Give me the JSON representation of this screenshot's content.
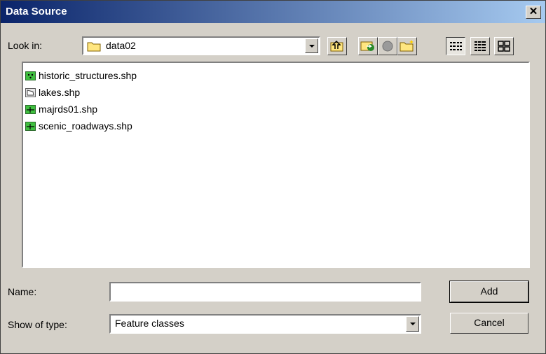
{
  "window": {
    "title": "Data Source",
    "close_glyph": "✕"
  },
  "lookin": {
    "label": "Look in:",
    "value": "data02",
    "icon": "folder-icon"
  },
  "toolbar": [
    {
      "name": "up-one-level-button",
      "icon": "up-folder-icon"
    },
    {
      "name": "connect-folder-button",
      "icon": "connect-folder-icon"
    },
    {
      "name": "disconnect-folder-button",
      "icon": "disconnect-folder-icon"
    },
    {
      "name": "new-folder-button",
      "icon": "new-folder-icon"
    },
    {
      "name": "list-view-button",
      "icon": "list-view-icon"
    },
    {
      "name": "details-view-button",
      "icon": "details-view-icon"
    },
    {
      "name": "thumbnails-view-button",
      "icon": "thumbnails-view-icon"
    }
  ],
  "files": [
    {
      "name": "historic_structures.shp",
      "icon": "point-feature-icon"
    },
    {
      "name": "lakes.shp",
      "icon": "polygon-feature-icon"
    },
    {
      "name": "majrds01.shp",
      "icon": "line-feature-icon"
    },
    {
      "name": "scenic_roadways.shp",
      "icon": "line-feature-icon"
    }
  ],
  "name_field": {
    "label": "Name:",
    "value": ""
  },
  "type_field": {
    "label": "Show of type:",
    "value": "Feature classes"
  },
  "buttons": {
    "add": "Add",
    "cancel": "Cancel"
  }
}
